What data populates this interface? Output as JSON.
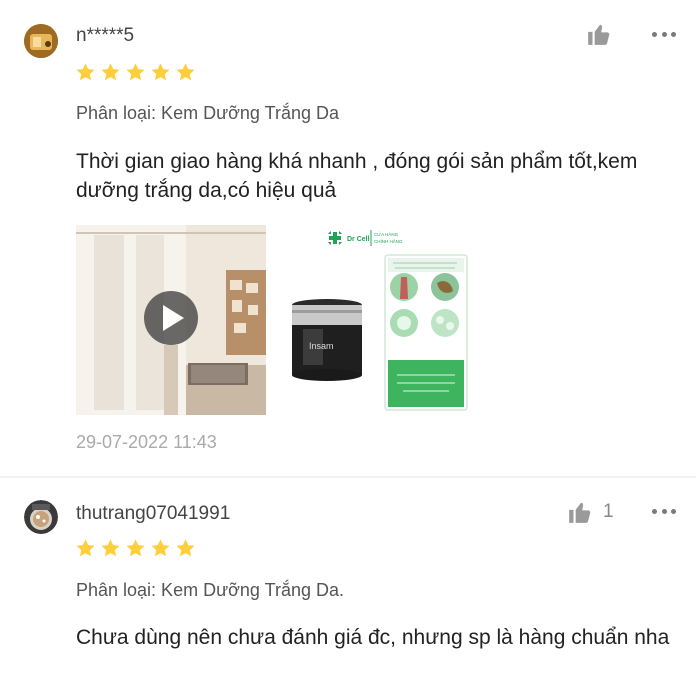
{
  "reviews": [
    {
      "username": "n*****5",
      "rating": 5,
      "variant": "Phân loại: Kem Dưỡng Trắng Da",
      "comment": "Thời gian giao hàng khá nhanh , đóng gói sản phẩm tốt,kem dưỡng trắng da,có hiệu quả",
      "timestamp": "29-07-2022 11:43",
      "likes": "",
      "photo_labels": {
        "brand": "Dr Cell",
        "store_line1": "CỬA HÀNG",
        "store_line2": "CHÍNH HÃNG",
        "jar_text": "Insam"
      }
    },
    {
      "username": "thutrang07041991",
      "rating": 5,
      "variant": "Phân loại: Kem Dưỡng Trắng Da.",
      "comment": "Chưa dùng nên chưa đánh giá đc, nhưng sp là hàng chuẩn nha",
      "likes": "1"
    }
  ],
  "colors": {
    "star": "#ffce3d",
    "divider": "#f1f1f1",
    "muted": "#888888",
    "timestamp": "#aaaaaa"
  },
  "icons": {
    "like": "thumbs-up-icon",
    "more": "more-horizontal-icon",
    "star": "star-icon",
    "play": "play-icon"
  }
}
